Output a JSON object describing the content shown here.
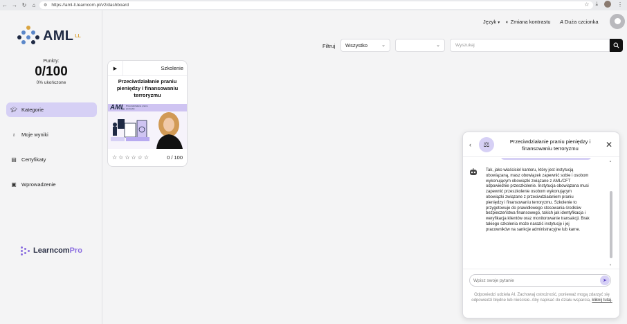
{
  "browser": {
    "url": "https://aml-ll.learncom.pl/v2/dashboard"
  },
  "brand": {
    "logo_text": "AML",
    "logo_sup": "LL",
    "footer_logo_a": "Learncom",
    "footer_logo_b": "Pro"
  },
  "stats": {
    "points_label": "Punkty:",
    "points_value": "0/100",
    "completion": "0% ukończone"
  },
  "sidebar": {
    "items": [
      {
        "label": "Kategorie",
        "icon": "graduation-cap-icon"
      },
      {
        "label": "Moje wyniki",
        "icon": "medal-icon"
      },
      {
        "label": "Certyfikaty",
        "icon": "certificate-icon"
      },
      {
        "label": "Wprowadzenie",
        "icon": "book-icon"
      }
    ]
  },
  "header": {
    "language": "Język",
    "contrast": "Zmiana kontrastu",
    "font_size": "Duża czcionka"
  },
  "filters": {
    "label": "Filtruj",
    "select1": "Wszystko",
    "select2": "",
    "search_placeholder": "Wyszukaj"
  },
  "course": {
    "type": "Szkolenie",
    "title": "Przeciwdziałanie praniu pieniędzy i finansowaniu terroryzmu",
    "banner_brand": "AML",
    "banner_small": "Przeciwdziałanie praniu pieniędzy",
    "score": "0 / 100",
    "stars": "☆☆☆☆☆☆"
  },
  "chat": {
    "title": "Przeciwdziałanie praniu pieniędzy i finansowaniu terroryzmu",
    "message": "Tak, jako właściciel kantoru, który jest instytucją obowiązaną, masz obowiązek zapewnić sobie i osobom wykonującym obowiązki związane z AML/CFT odpowiednie przeszkolenie. Instytucja obowiązana musi zapewnić przeszkolenie osobom wykonującym obowiązki związane z przeciwdziałaniem praniu pieniędzy i finansowaniu terroryzmu. Szkolenie to przygotowuje do prawidłowego stosowania środków bezpieczeństwa finansowego, takich jak identyfikacja i weryfikacja klientów oraz monitorowanie transakcji. Brak takiego szkolenia może narazić instytucję i jej pracowników na sankcje administracyjne lub karne.",
    "input_placeholder": "Wpisz swoje pytanie",
    "disclaimer": "Odpowiedzi udziela AI. Zachowaj ostrożność, ponieważ mogą zdarzyć się odpowiedzi błędne lub nieścisłe. Aby napisać do działu wsparcia,",
    "disclaimer_link": "kliknij tutaj."
  },
  "colors": {
    "accent": "#d6d0f5",
    "brand_dark": "#1f2a44",
    "brand_purple": "#8b6ee0"
  }
}
